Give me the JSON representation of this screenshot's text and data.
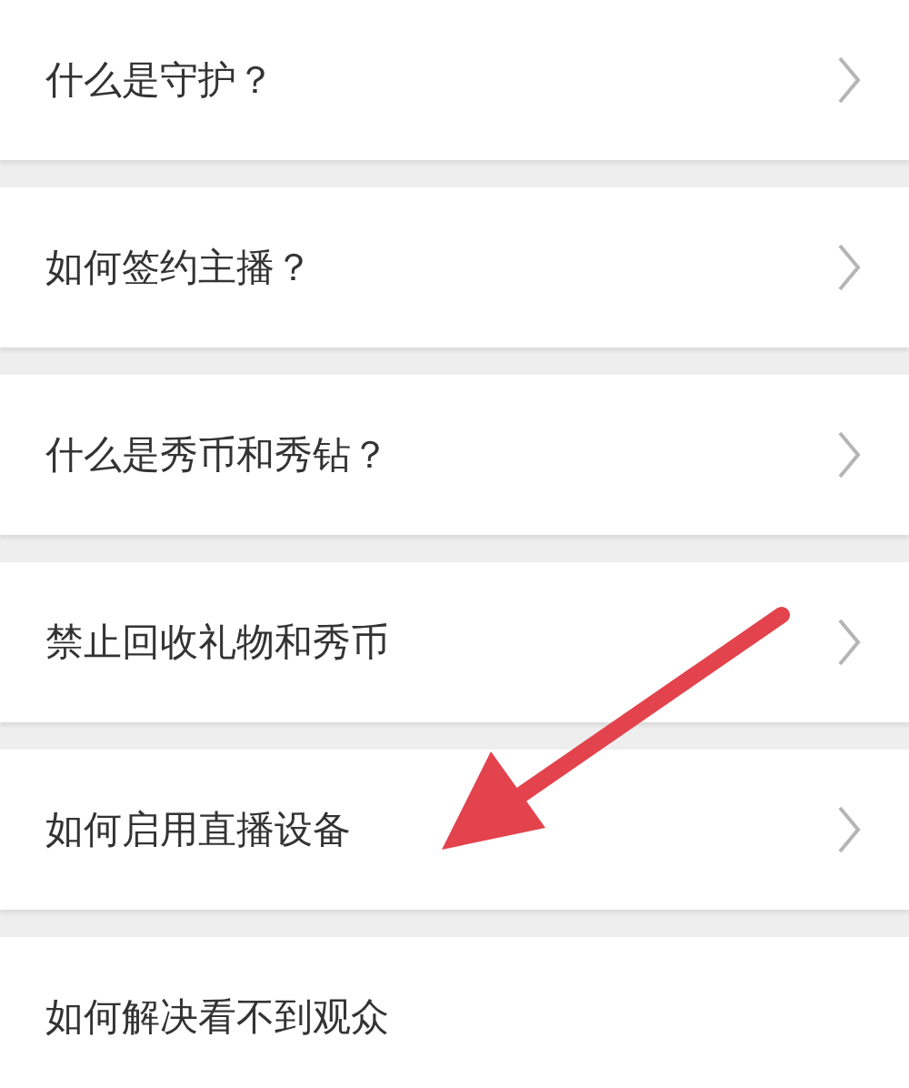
{
  "faq_items": [
    {
      "label": "什么是守护？",
      "chevron": true
    },
    {
      "label": "如何签约主播？",
      "chevron": true
    },
    {
      "label": "什么是秀币和秀钻？",
      "chevron": true
    },
    {
      "label": "禁止回收礼物和秀币",
      "chevron": true
    },
    {
      "label": "如何启用直播设备",
      "chevron": true
    },
    {
      "label": "如何解决看不到观众",
      "chevron": false
    }
  ],
  "annotation": {
    "kind": "arrow",
    "color": "#e2434d"
  }
}
